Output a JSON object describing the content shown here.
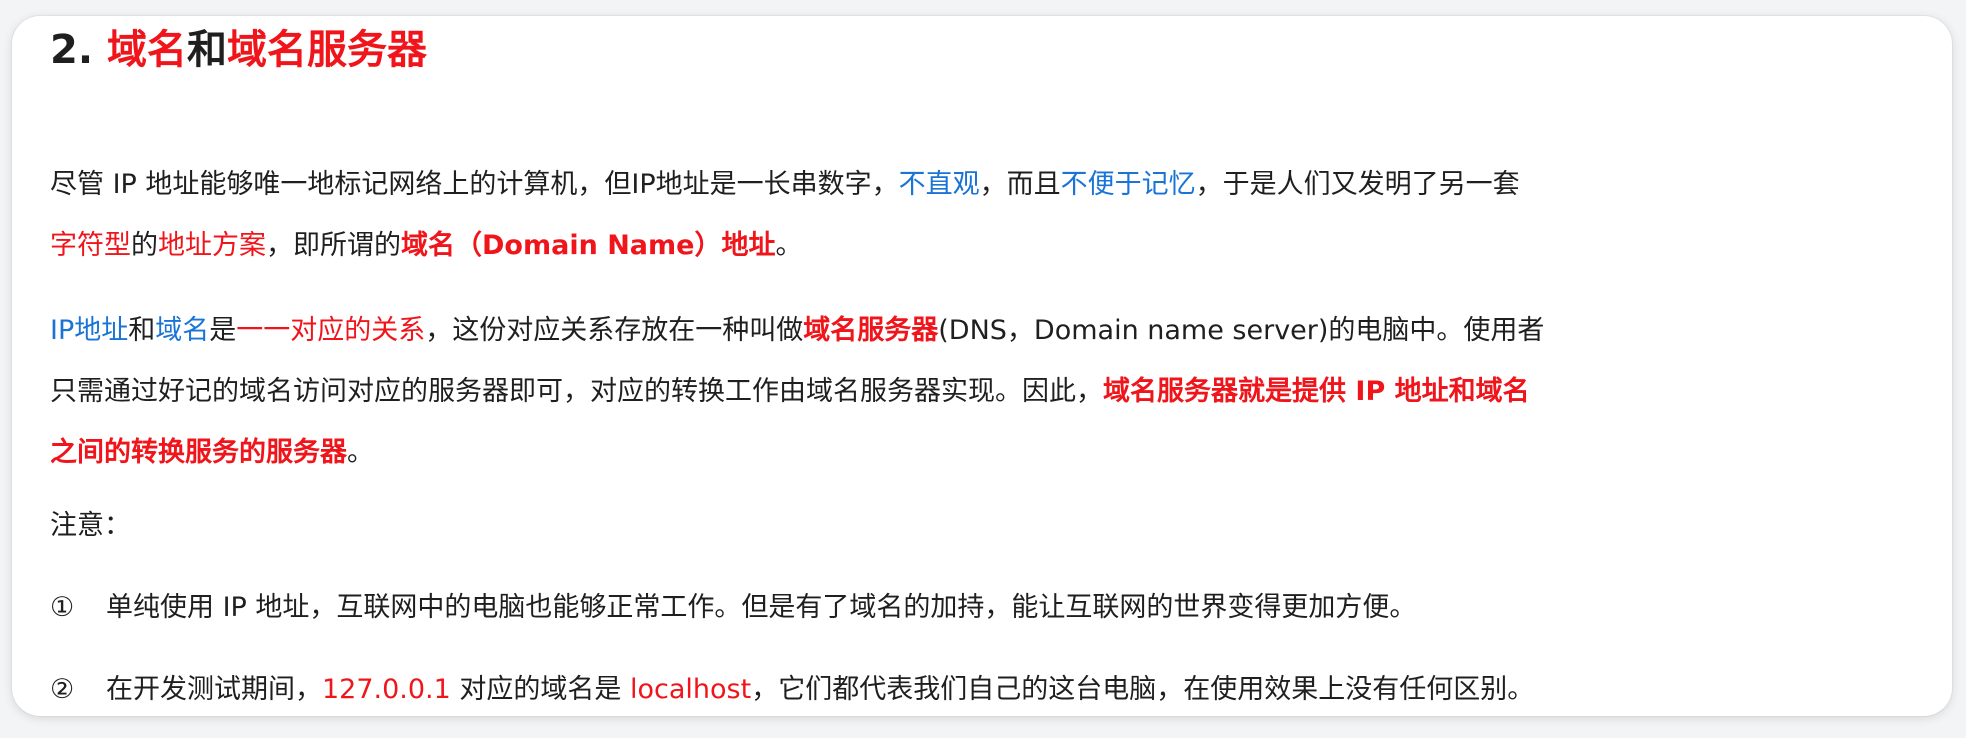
{
  "heading": {
    "num": "2. ",
    "part1": "域名",
    "part2": "和",
    "part3": "域名服务器"
  },
  "para1": {
    "l1_a": "尽管 IP 地址能够唯一地标记网络上的计算机，但IP地址是一长串数字，",
    "l1_b": "不直观",
    "l1_c": "，而且",
    "l1_d": "不便于记忆",
    "l1_e": "，于是人们又发明了另一套",
    "l2_a": "字符型",
    "l2_b": "的",
    "l2_c": "地址方案",
    "l2_d": "，即所谓的",
    "l2_e": "域名（Domain Name）地址",
    "l2_f": "。"
  },
  "para2": {
    "l1_a": "IP地址",
    "l1_b": "和",
    "l1_c": "域名",
    "l1_d": "是",
    "l1_e": "一一对应的关系",
    "l1_f": "，这份对应关系存放在一种叫做",
    "l1_g": "域名服务器",
    "l1_h": "(DNS，Domain name server)的电脑中。使用者",
    "l2_a": "只需通过好记的域名访问对应的服务器即可，对应的转换工作由域名服务器实现。因此，",
    "l2_b": "域名服务器就是提供 IP 地址和域名",
    "l3_a": "之间的转换服务的服务器",
    "l3_b": "。"
  },
  "note_label": "注意：",
  "items": [
    {
      "marker": "①",
      "text": "单纯使用 IP 地址，互联网中的电脑也能够正常工作。但是有了域名的加持，能让互联网的世界变得更加方便。"
    },
    {
      "marker": "②",
      "a": "在开发测试期间，",
      "b": "127.0.0.1",
      "c": " 对应的域名是 ",
      "d": "localhost",
      "e": "，它们都代表我们自己的这台电脑，在使用效果上没有任何区别。"
    }
  ]
}
